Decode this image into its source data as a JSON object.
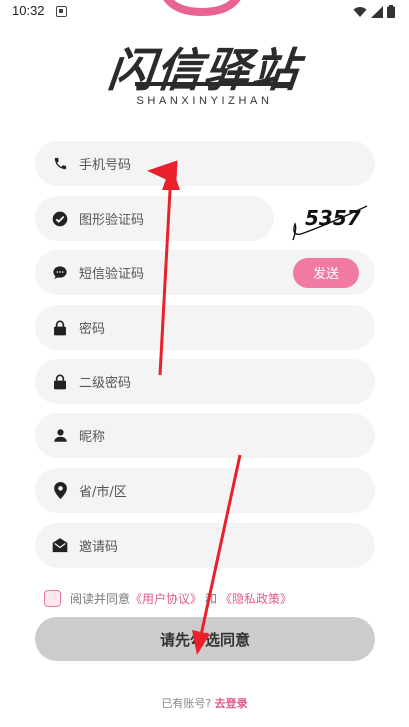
{
  "status_bar": {
    "time": "10:32"
  },
  "brand": {
    "title_cn": "闪信驿站",
    "title_en": "SHANXINYIZHAN"
  },
  "form": {
    "phone": {
      "placeholder": "手机号码",
      "icon": "phone-icon"
    },
    "image_code": {
      "placeholder": "图形验证码",
      "icon": "check-circle-icon"
    },
    "captcha_text": "5357",
    "sms_code": {
      "placeholder": "短信验证码",
      "icon": "chat-bubble-icon",
      "send_label": "发送"
    },
    "password": {
      "placeholder": "密码",
      "icon": "lock-icon"
    },
    "password2": {
      "placeholder": "二级密码",
      "icon": "lock-icon"
    },
    "nickname": {
      "placeholder": "昵称",
      "icon": "person-icon"
    },
    "region": {
      "placeholder": "省/市/区",
      "icon": "location-pin-icon"
    },
    "invite": {
      "placeholder": "邀请码",
      "icon": "mail-icon"
    }
  },
  "agreement": {
    "prefix": "阅读并同意",
    "user_agreement": "《用户协议》",
    "and": "和",
    "privacy_policy": "《隐私政策》"
  },
  "submit_label": "请先勾选同意",
  "login": {
    "prompt": "已有账号?",
    "link": "去登录"
  },
  "colors": {
    "accent": "#f07aa3",
    "link": "#e05a8e",
    "field_bg": "#f4f4f4",
    "submit_bg": "#cccccc",
    "arrow": "#e8212b"
  }
}
